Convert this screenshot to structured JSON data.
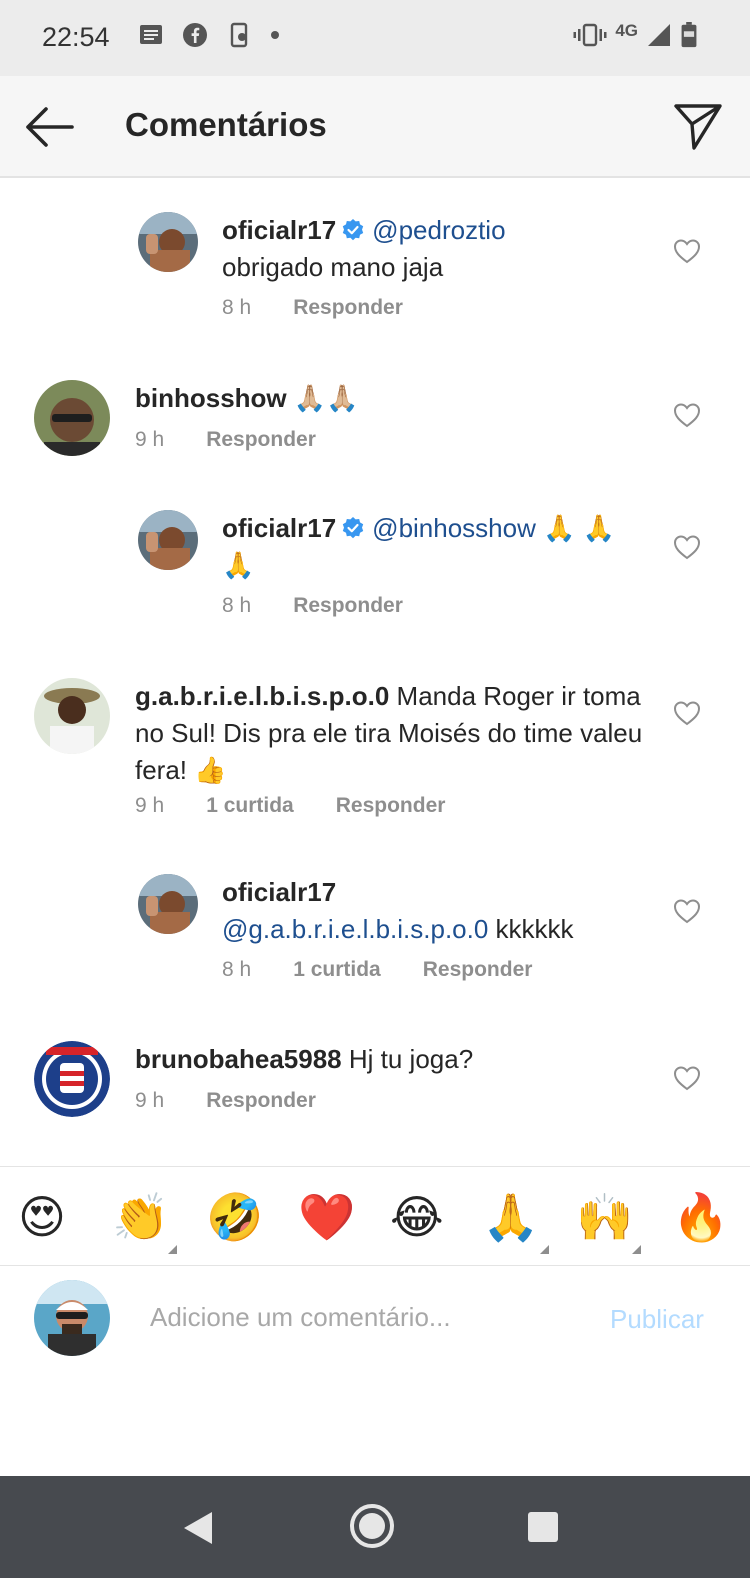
{
  "status_bar": {
    "time": "22:54",
    "left_icons": [
      "message-icon",
      "facebook-icon",
      "screenshot-icon",
      "dot-icon"
    ],
    "right_icons": [
      "vibrate-icon",
      "network-4g-icon",
      "signal-icon",
      "battery-icon"
    ],
    "network_label": "4G"
  },
  "header": {
    "title": "Comentários",
    "back_icon": "arrow-left-icon",
    "send_icon": "paper-plane-icon"
  },
  "comments": [
    {
      "username": "oficialr17",
      "verified": true,
      "mention": "@pedroztio",
      "text": "obrigado mano jaja",
      "time": "8 h",
      "likes": "",
      "reply_label": "Responder",
      "is_reply": true
    },
    {
      "username": "binhosshow",
      "verified": false,
      "mention": "",
      "text": "🙏🏼🙏🏼",
      "time": "9 h",
      "likes": "",
      "reply_label": "Responder",
      "is_reply": false
    },
    {
      "username": "oficialr17",
      "verified": true,
      "mention": "@binhosshow",
      "text": "🙏 🙏🙏",
      "time": "8 h",
      "likes": "",
      "reply_label": "Responder",
      "is_reply": true
    },
    {
      "username": "g.a.b.r.i.e.l.b.i.s.p.o.0",
      "verified": false,
      "mention": "",
      "text": "Manda Roger ir toma no Sul! Dis pra ele tira Moisés do time valeu fera! 👍",
      "time": "9 h",
      "likes": "1 curtida",
      "reply_label": "Responder",
      "is_reply": false
    },
    {
      "username": "oficialr17",
      "verified": false,
      "mention": "@g.a.b.r.i.e.l.b.i.s.p.o.0",
      "text": "kkkkkk",
      "time": "8 h",
      "likes": "1 curtida",
      "reply_label": "Responder",
      "is_reply": true
    },
    {
      "username": "brunobahea5988",
      "verified": false,
      "mention": "",
      "text": "Hj tu joga?",
      "time": "9 h",
      "likes": "",
      "reply_label": "Responder",
      "is_reply": false
    }
  ],
  "emoji_bar": [
    "😍",
    "👏",
    "🤣",
    "❤️",
    "😂",
    "🙏",
    "🙌",
    "🔥"
  ],
  "input": {
    "placeholder": "Adicione um comentário...",
    "value": "",
    "publish_label": "Publicar"
  },
  "colors": {
    "mention": "#1e4f8f",
    "verified": "#3897f0",
    "publish_disabled": "#b3dbff",
    "meta_gray": "#8e8e8e",
    "nav_bar": "#474a4f"
  },
  "nav": {
    "icons": [
      "back-triangle-icon",
      "home-circle-icon",
      "recents-square-icon"
    ]
  }
}
